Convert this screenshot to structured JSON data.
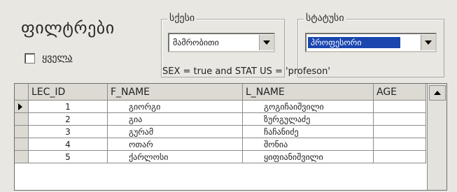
{
  "filter": {
    "title": "ფილტრები",
    "all_label": "ყველა",
    "sex_legend": "სქესი",
    "sex_value": "მამრობითი",
    "status_legend": "სტატუსი",
    "status_value": "პროფესორი",
    "query_text": "SEX = true and STAT US = 'profeson'"
  },
  "grid": {
    "columns": [
      "LEC_ID",
      "F_NAME",
      "L_NAME",
      "AGE"
    ],
    "rows": [
      {
        "id": "1",
        "f": "გიორგი",
        "l": "გოგიჩაიშვილი",
        "age": ""
      },
      {
        "id": "2",
        "f": "გია",
        "l": "ზურგულაძე",
        "age": ""
      },
      {
        "id": "3",
        "f": "გურამ",
        "l": "ჩაჩანიძე",
        "age": ""
      },
      {
        "id": "4",
        "f": "ოთარ",
        "l": "შონია",
        "age": ""
      },
      {
        "id": "5",
        "f": "ქარლოსი",
        "l": "ყიფიანიშვილი",
        "age": ""
      }
    ]
  },
  "colors": {
    "selection": "#1a46ae",
    "window_bg": "#e9e7e1"
  }
}
